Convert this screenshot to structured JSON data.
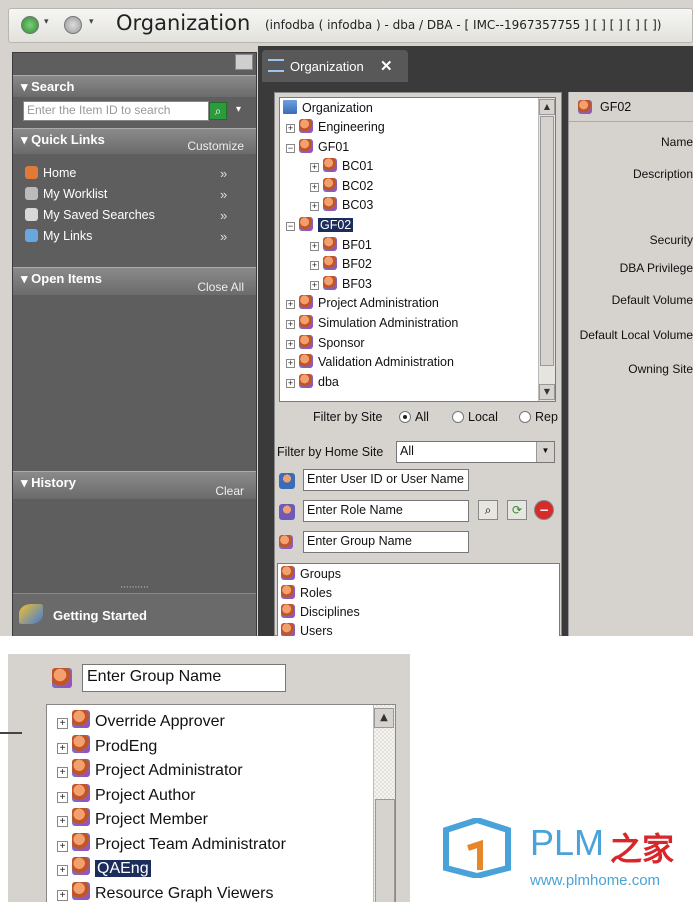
{
  "titlebar": {
    "title": "Organization",
    "subtitle": "(infodba ( infodba ) - dba / DBA - [ IMC--1967357755 ] [ ] [ ] [ ] [ ])"
  },
  "left_pane": {
    "search": {
      "header": "Search",
      "placeholder": "Enter the Item ID to search",
      "dropdown_glyph": "▾"
    },
    "quick_links": {
      "header": "Quick Links",
      "action": "Customize",
      "items": [
        {
          "label": "Home",
          "icon": "home-icon",
          "chevron": "»"
        },
        {
          "label": "My Worklist",
          "icon": "worklist-icon",
          "chevron": "»"
        },
        {
          "label": "My Saved Searches",
          "icon": "saved-searches-icon",
          "chevron": "»"
        },
        {
          "label": "My Links",
          "icon": "links-icon",
          "chevron": "»"
        }
      ]
    },
    "open_items": {
      "header": "Open Items",
      "action": "Close All"
    },
    "history": {
      "header": "History",
      "action": "Clear"
    },
    "getting_started": "Getting Started",
    "grip": "··········"
  },
  "tab": {
    "label": "Organization",
    "close": "✕"
  },
  "tree": {
    "root": "Organization",
    "rows": [
      {
        "label": "Engineering",
        "level": 1,
        "expander": "+"
      },
      {
        "label": "GF01",
        "level": 1,
        "expander": "−"
      },
      {
        "label": "BC01",
        "level": 2,
        "expander": "+"
      },
      {
        "label": "BC02",
        "level": 2,
        "expander": "+"
      },
      {
        "label": "BC03",
        "level": 2,
        "expander": "+"
      },
      {
        "label": "GF02",
        "level": 1,
        "expander": "−",
        "selected": true
      },
      {
        "label": "BF01",
        "level": 2,
        "expander": "+"
      },
      {
        "label": "BF02",
        "level": 2,
        "expander": "+"
      },
      {
        "label": "BF03",
        "level": 2,
        "expander": "+"
      },
      {
        "label": "Project Administration",
        "level": 1,
        "expander": "+"
      },
      {
        "label": "Simulation Administration",
        "level": 1,
        "expander": "+"
      },
      {
        "label": "Sponsor",
        "level": 1,
        "expander": "+"
      },
      {
        "label": "Validation Administration",
        "level": 1,
        "expander": "+"
      },
      {
        "label": "dba",
        "level": 1,
        "expander": "+"
      }
    ]
  },
  "filters": {
    "by_site_label": "Filter by Site",
    "options": [
      "All",
      "Local",
      "Rep"
    ],
    "selected": "All",
    "home_site_label": "Filter by Home Site",
    "home_site_value": "All"
  },
  "inputs": {
    "user": "Enter User ID or User Name",
    "role": "Enter Role Name",
    "group": "Enter Group Name"
  },
  "category_list": [
    "Groups",
    "Roles",
    "Disciplines",
    "Users"
  ],
  "right_pane": {
    "selected_name": "GF02",
    "properties": [
      "Name",
      "Description",
      "Security",
      "DBA Privilege",
      "Default Volume",
      "Default Local Volume",
      "Owning Site"
    ]
  },
  "bottom": {
    "group_input": "Enter Group Name",
    "roles": [
      "Override Approver",
      "ProdEng",
      "Project Administrator",
      "Project Author",
      "Project Member",
      "Project Team Administrator",
      "QAEng",
      "Resource Graph Viewers"
    ],
    "selected_role": "QAEng"
  },
  "watermark": {
    "brand_latin": "PLM",
    "brand_cjk": "之家",
    "url": "www.plmhome.com"
  },
  "colors": {
    "selection": "#1c2d5c",
    "pane_dark": "#5e5e5e",
    "tab_bar": "#3a3a3a",
    "brand_blue": "#4aa3d8",
    "brand_orange": "#e8862a",
    "brand_red": "#d9262a"
  }
}
